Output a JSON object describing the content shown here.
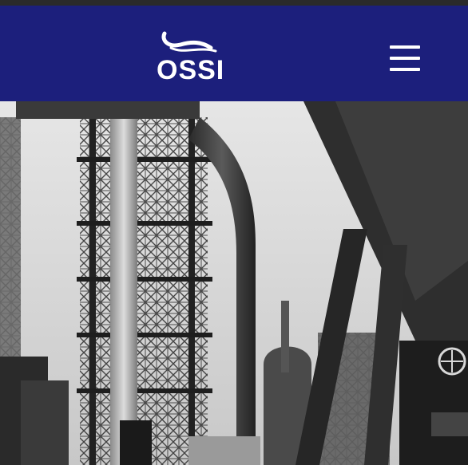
{
  "header": {
    "brand": "OSSI",
    "logo_icon": "wave-logo-icon",
    "menu_icon": "hamburger-menu-icon",
    "background": "#1c1f7c"
  },
  "hero": {
    "subject": "industrial-blast-furnace-photo",
    "style": "black-and-white"
  }
}
